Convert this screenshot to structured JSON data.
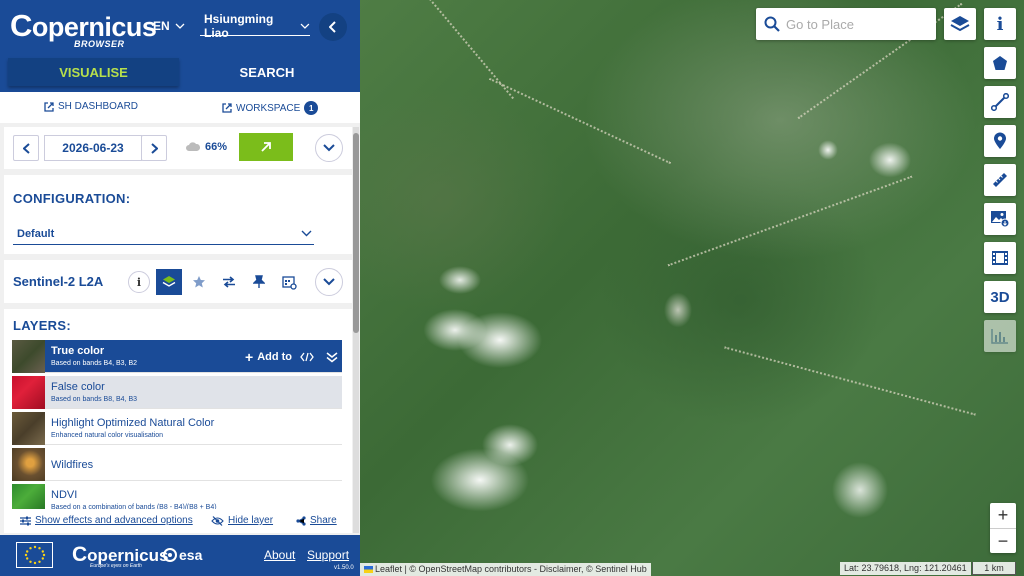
{
  "header": {
    "logo_text": "opernicus",
    "logo_sub": "BROWSER",
    "language": "EN",
    "user": "Hsiungming Liao"
  },
  "tabs": {
    "visualise": "VISUALISE",
    "search": "SEARCH"
  },
  "links": {
    "sh_dashboard": "SH DASHBOARD",
    "workspace": "WORKSPACE",
    "workspace_count": "1"
  },
  "date_row": {
    "date": "2026-06-23",
    "cloud_coverage": "66%"
  },
  "configuration": {
    "title": "CONFIGURATION:",
    "selected": "Default"
  },
  "dataset": {
    "name": "Sentinel-2 L2A"
  },
  "layers": {
    "title": "LAYERS:",
    "add_to": "Add to",
    "items": [
      {
        "name": "True color",
        "desc": "Based on bands B4, B3, B2"
      },
      {
        "name": "False color",
        "desc": "Based on bands B8, B4, B3"
      },
      {
        "name": "Highlight Optimized Natural Color",
        "desc": "Enhanced natural color visualisation"
      },
      {
        "name": "Wildfires",
        "desc": ""
      },
      {
        "name": "NDVI",
        "desc": "Based on a combination of bands (B8 - B4)/(B8 + B4)"
      }
    ]
  },
  "actions": {
    "effects": "Show effects and advanced options",
    "hide_layer": "Hide layer",
    "share": "Share"
  },
  "footer": {
    "copernicus": "opernicus",
    "copernicus_sub": "Europe's eyes on Earth",
    "esa": "esa",
    "about": "About",
    "support": "Support",
    "version": "v1.50.0"
  },
  "map": {
    "search_placeholder": "Go to Place",
    "tool_3d": "3D",
    "attribution": "Leaflet | © OpenStreetMap contributors - Disclaimer, © Sentinel Hub",
    "coords": "Lat: 23.79618, Lng: 121.20461",
    "scale": "1 km",
    "zoom_in": "+",
    "zoom_out": "−"
  },
  "colors": {
    "brand": "#1a4b97",
    "accent": "#7bbd1b",
    "tab_active_text": "#b7e04c"
  }
}
